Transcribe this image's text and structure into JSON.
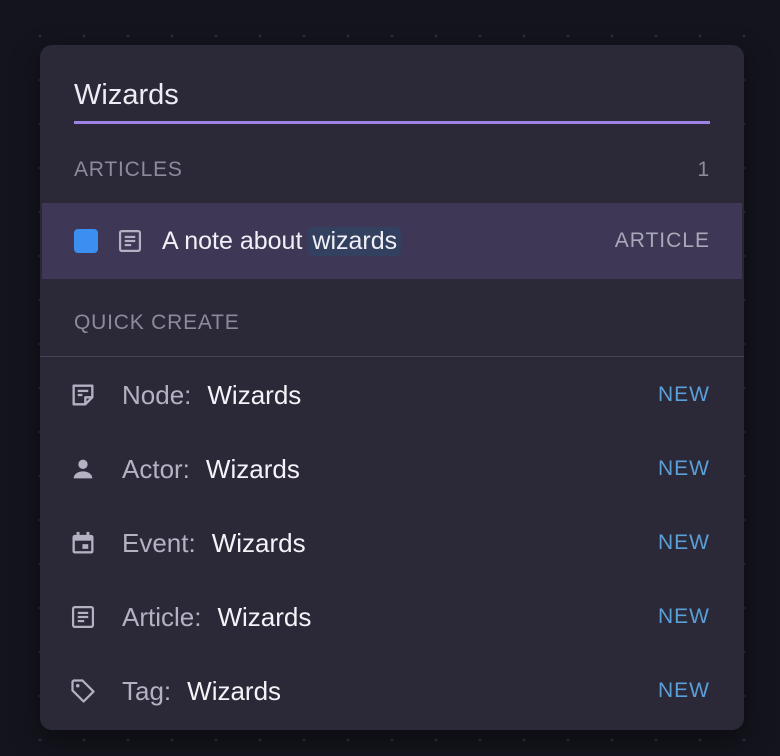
{
  "search": {
    "value": "Wizards"
  },
  "articles_section": {
    "title": "ARTICLES",
    "count": "1"
  },
  "article_result": {
    "title_prefix": "A note about",
    "title_match": "wizards",
    "type": "ARTICLE",
    "color": "#3b8ff0",
    "icon": "article-icon"
  },
  "quick_create": {
    "title": "QUICK CREATE",
    "items": [
      {
        "kind": "Node:",
        "value": "Wizards",
        "tag": "NEW",
        "icon": "node-icon"
      },
      {
        "kind": "Actor:",
        "value": "Wizards",
        "tag": "NEW",
        "icon": "person-icon"
      },
      {
        "kind": "Event:",
        "value": "Wizards",
        "tag": "NEW",
        "icon": "calendar-icon"
      },
      {
        "kind": "Article:",
        "value": "Wizards",
        "tag": "NEW",
        "icon": "article-icon"
      },
      {
        "kind": "Tag:",
        "value": "Wizards",
        "tag": "NEW",
        "icon": "tag-icon"
      }
    ]
  },
  "colors": {
    "accent": "#9d82e6",
    "new": "#5a9fd8",
    "selected_row": "#3e3856"
  }
}
